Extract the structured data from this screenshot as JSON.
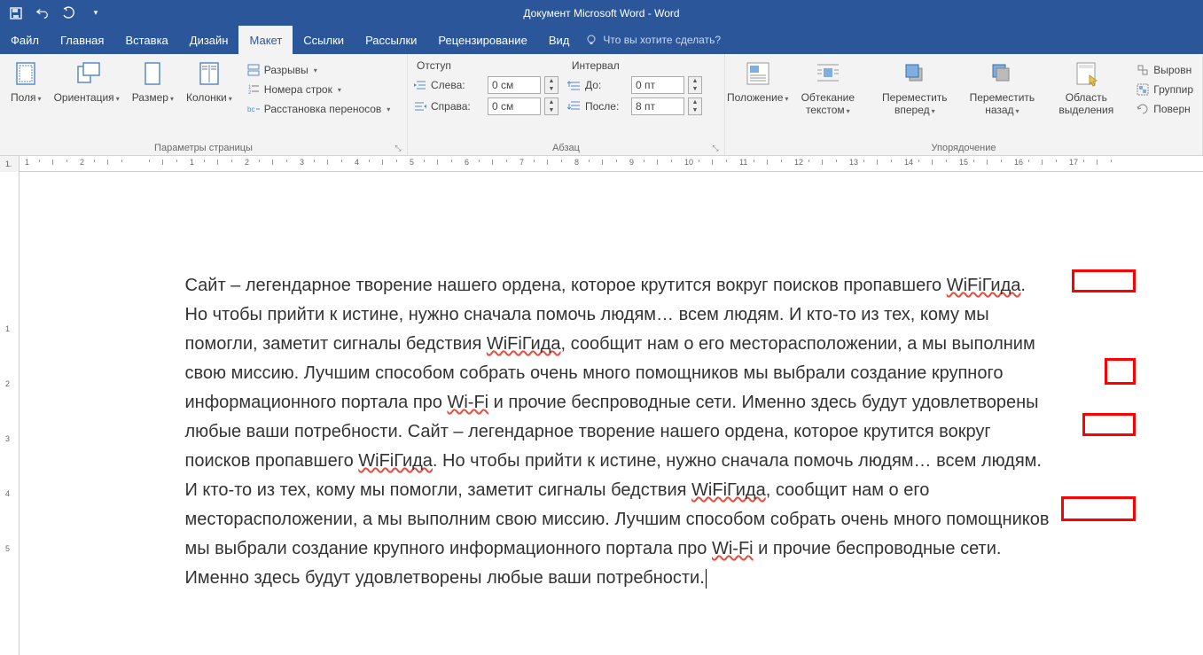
{
  "app_title": "Документ Microsoft Word - Word",
  "menu": {
    "file": "Файл",
    "home": "Главная",
    "insert": "Вставка",
    "design": "Дизайн",
    "layout": "Макет",
    "references": "Ссылки",
    "mailings": "Рассылки",
    "review": "Рецензирование",
    "view": "Вид",
    "tellme": "Что вы хотите сделать?"
  },
  "ribbon": {
    "page_setup": {
      "label": "Параметры страницы",
      "margins": "Поля",
      "orientation": "Ориентация",
      "size": "Размер",
      "columns": "Колонки",
      "breaks": "Разрывы",
      "line_numbers": "Номера строк",
      "hyphenation": "Расстановка переносов"
    },
    "paragraph": {
      "label": "Абзац",
      "indent_header": "Отступ",
      "spacing_header": "Интервал",
      "left_label": "Слева:",
      "right_label": "Справа:",
      "left_val": "0 см",
      "right_val": "0 см",
      "before_label": "До:",
      "after_label": "После:",
      "before_val": "0 пт",
      "after_val": "8 пт"
    },
    "arrange": {
      "label": "Упорядочение",
      "position": "Положение",
      "wrap": "Обтекание текстом",
      "forward": "Переместить вперед",
      "backward": "Переместить назад",
      "selection": "Область выделения",
      "align": "Выровн",
      "group": "Группир",
      "rotate": "Поверн"
    }
  },
  "ruler_corner": "∟",
  "document": {
    "p1": "Сайт – легендарное творение нашего ордена, которое крутится вокруг поисков пропавшего ",
    "wifi1": "WiFiГида",
    "p2": ". Но чтобы прийти к истине, нужно сначала помочь людям… всем людям. И кто-то из тех, кому мы помогли, заметит сигналы бедствия ",
    "wifi2": "WiFiГида",
    "p3": ", сообщит нам о его месторасположении, а мы выполним свою миссию. Лучшим способом собрать очень много помощников мы выбрали создание крупного информационного портала про ",
    "wifi_label1": "Wi-Fi",
    "p4": " и прочие беспроводные сети. Именно здесь будут удовлетворены любые ваши потребности. Сайт – легендарное творение нашего ордена, которое крутится вокруг поисков пропавшего ",
    "wifi3": "WiFiГида",
    "p5": ". Но чтобы прийти к истине, нужно сначала помочь людям… всем людям. И кто-то из тех, кому мы помогли, заметит сигналы бедствия ",
    "wifi4": "WiFiГида",
    "p6": ", сообщит нам о его месторасположении, а мы выполним свою миссию. Лучшим способом собрать очень много помощников мы выбрали создание крупного информационного портала про ",
    "wifi_label2": "Wi-Fi",
    "p7": " и прочие беспроводные сети. Именно здесь будут удовлетворены любые ваши потребности."
  },
  "ruler_numbers": [
    "",
    "1",
    "2",
    "",
    "1",
    "2",
    "3",
    "4",
    "5",
    "6",
    "7",
    "8",
    "9",
    "10",
    "11",
    "12",
    "13",
    "14",
    "15",
    "16",
    "17"
  ],
  "vruler_numbers": [
    "",
    "1",
    "",
    "",
    "1",
    "2",
    "3",
    "4",
    "5"
  ]
}
